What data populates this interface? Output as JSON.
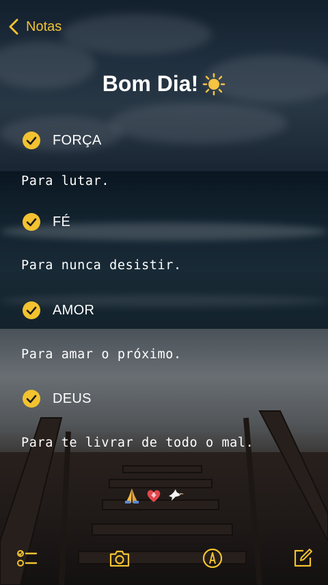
{
  "nav": {
    "back_label": "Notas"
  },
  "note": {
    "title": "Bom Dia!",
    "items": [
      {
        "label": "FORÇA",
        "checked": true,
        "text": "Para lutar."
      },
      {
        "label": "FÉ",
        "checked": true,
        "text": "Para nunca desistir."
      },
      {
        "label": "AMOR",
        "checked": true,
        "text": "Para amar o próximo."
      },
      {
        "label": "DEUS",
        "checked": true,
        "text": "Para te livrar de todo o mal."
      }
    ],
    "emojis": [
      "praying-hands-icon",
      "heart-with-ribbon-icon",
      "dove-icon"
    ]
  },
  "toolbar": {
    "icons": [
      "checklist-icon",
      "camera-icon",
      "markup-pen-icon",
      "compose-icon"
    ]
  },
  "colors": {
    "accent": "#f2c230",
    "text": "#ffffff"
  }
}
